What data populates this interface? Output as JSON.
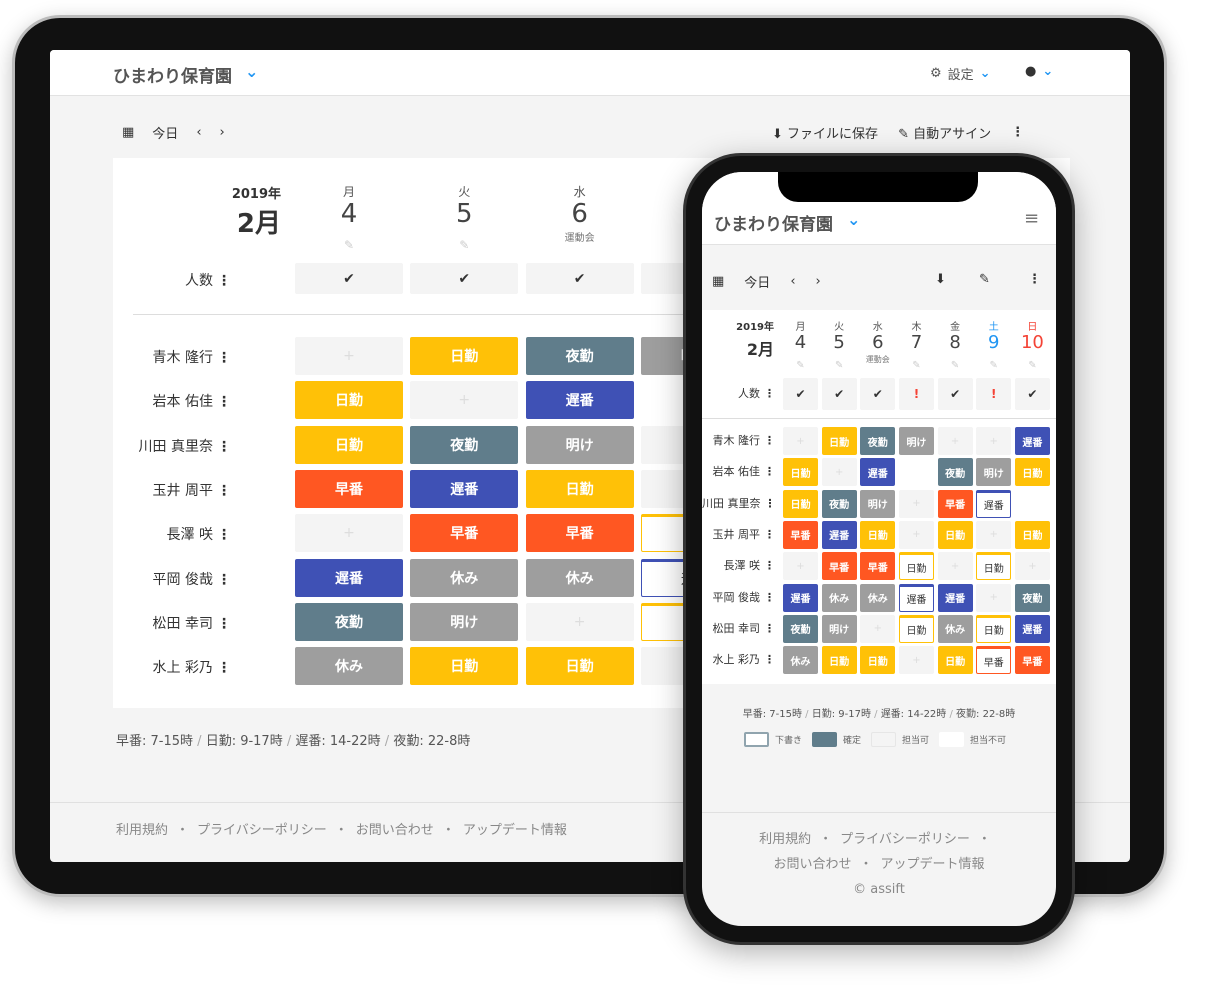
{
  "app": {
    "org_name": "ひまわり保育園",
    "settings_label": "設定",
    "today_label": "今日",
    "save_file_label": "ファイルに保存",
    "auto_assign_label": "自動アサイン"
  },
  "calendar": {
    "year": "2019年",
    "month": "2月",
    "count_label": "人数",
    "days": [
      {
        "dow": "月",
        "date": "4",
        "note": "",
        "status": "ok"
      },
      {
        "dow": "火",
        "date": "5",
        "note": "",
        "status": "ok"
      },
      {
        "dow": "水",
        "date": "6",
        "note": "運動会",
        "status": "ok"
      },
      {
        "dow": "木",
        "date": "7",
        "note": "",
        "status": "warn"
      },
      {
        "dow": "金",
        "date": "8",
        "note": "",
        "status": "ok"
      },
      {
        "dow": "土",
        "date": "9",
        "note": "",
        "status": "warn"
      },
      {
        "dow": "日",
        "date": "10",
        "note": "",
        "status": "ok"
      }
    ]
  },
  "status_icons": {
    "ok": "✔",
    "warn": "!"
  },
  "colors": {
    "日勤": "#FFC107",
    "夜勤": "#607D8B",
    "明け": "#9E9E9E",
    "遅番": "#3F51B5",
    "早番": "#FF5722",
    "休み": "#9E9E9E",
    "saturday": "#2196F3",
    "sunday": "#F44336",
    "warn": "#F44336",
    "accent": "#2196F3"
  },
  "schedule": {
    "rows": [
      {
        "name": "青木 隆行",
        "cells": [
          {
            "label": "+",
            "state": "available"
          },
          {
            "label": "日勤",
            "state": "confirmed"
          },
          {
            "label": "夜勤",
            "state": "confirmed"
          },
          {
            "label": "明け",
            "state": "confirmed"
          },
          {
            "label": "+",
            "state": "available"
          },
          {
            "label": "+",
            "state": "available"
          },
          {
            "label": "遅番",
            "state": "confirmed"
          }
        ]
      },
      {
        "name": "岩本 佑佳",
        "cells": [
          {
            "label": "日勤",
            "state": "confirmed"
          },
          {
            "label": "+",
            "state": "available"
          },
          {
            "label": "遅番",
            "state": "confirmed"
          },
          {
            "label": "",
            "state": "unavailable"
          },
          {
            "label": "夜勤",
            "state": "confirmed"
          },
          {
            "label": "明け",
            "state": "confirmed"
          },
          {
            "label": "日勤",
            "state": "confirmed"
          }
        ]
      },
      {
        "name": "川田 真里奈",
        "cells": [
          {
            "label": "日勤",
            "state": "confirmed"
          },
          {
            "label": "夜勤",
            "state": "confirmed"
          },
          {
            "label": "明け",
            "state": "confirmed"
          },
          {
            "label": "+",
            "state": "available"
          },
          {
            "label": "早番",
            "state": "confirmed"
          },
          {
            "label": "遅番",
            "state": "draft"
          },
          {
            "label": "",
            "state": "unavailable"
          }
        ]
      },
      {
        "name": "玉井 周平",
        "cells": [
          {
            "label": "早番",
            "state": "confirmed"
          },
          {
            "label": "遅番",
            "state": "confirmed"
          },
          {
            "label": "日勤",
            "state": "confirmed"
          },
          {
            "label": "+",
            "state": "available"
          },
          {
            "label": "日勤",
            "state": "confirmed"
          },
          {
            "label": "+",
            "state": "available"
          },
          {
            "label": "日勤",
            "state": "confirmed"
          }
        ]
      },
      {
        "name": "長澤 咲",
        "cells": [
          {
            "label": "+",
            "state": "available"
          },
          {
            "label": "早番",
            "state": "confirmed"
          },
          {
            "label": "早番",
            "state": "confirmed"
          },
          {
            "label": "日勤",
            "state": "draft"
          },
          {
            "label": "+",
            "state": "available"
          },
          {
            "label": "日勤",
            "state": "draft"
          },
          {
            "label": "+",
            "state": "available"
          }
        ]
      },
      {
        "name": "平岡 俊哉",
        "cells": [
          {
            "label": "遅番",
            "state": "confirmed"
          },
          {
            "label": "休み",
            "state": "confirmed"
          },
          {
            "label": "休み",
            "state": "confirmed"
          },
          {
            "label": "遅番",
            "state": "draft"
          },
          {
            "label": "遅番",
            "state": "confirmed"
          },
          {
            "label": "+",
            "state": "available"
          },
          {
            "label": "夜勤",
            "state": "confirmed"
          }
        ]
      },
      {
        "name": "松田 幸司",
        "cells": [
          {
            "label": "夜勤",
            "state": "confirmed"
          },
          {
            "label": "明け",
            "state": "confirmed"
          },
          {
            "label": "+",
            "state": "available"
          },
          {
            "label": "日勤",
            "state": "draft"
          },
          {
            "label": "休み",
            "state": "confirmed"
          },
          {
            "label": "日勤",
            "state": "draft"
          },
          {
            "label": "遅番",
            "state": "confirmed"
          }
        ]
      },
      {
        "name": "水上 彩乃",
        "cells": [
          {
            "label": "休み",
            "state": "confirmed"
          },
          {
            "label": "日勤",
            "state": "confirmed"
          },
          {
            "label": "日勤",
            "state": "confirmed"
          },
          {
            "label": "+",
            "state": "available"
          },
          {
            "label": "日勤",
            "state": "confirmed"
          },
          {
            "label": "早番",
            "state": "draft"
          },
          {
            "label": "早番",
            "state": "confirmed"
          }
        ]
      }
    ]
  },
  "shift_times": [
    "早番: 7-15時",
    "日勤: 9-17時",
    "遅番: 14-22時",
    "夜勤: 22-8時"
  ],
  "legend": [
    {
      "label": "下書き",
      "key": "draft"
    },
    {
      "label": "確定",
      "key": "confirmed"
    },
    {
      "label": "担当可",
      "key": "available"
    },
    {
      "label": "担当不可",
      "key": "unavailable"
    }
  ],
  "footer": {
    "links": [
      "利用規約",
      "プライバシーポリシー",
      "お問い合わせ",
      "アップデート情報"
    ],
    "copyright": "© assift"
  }
}
